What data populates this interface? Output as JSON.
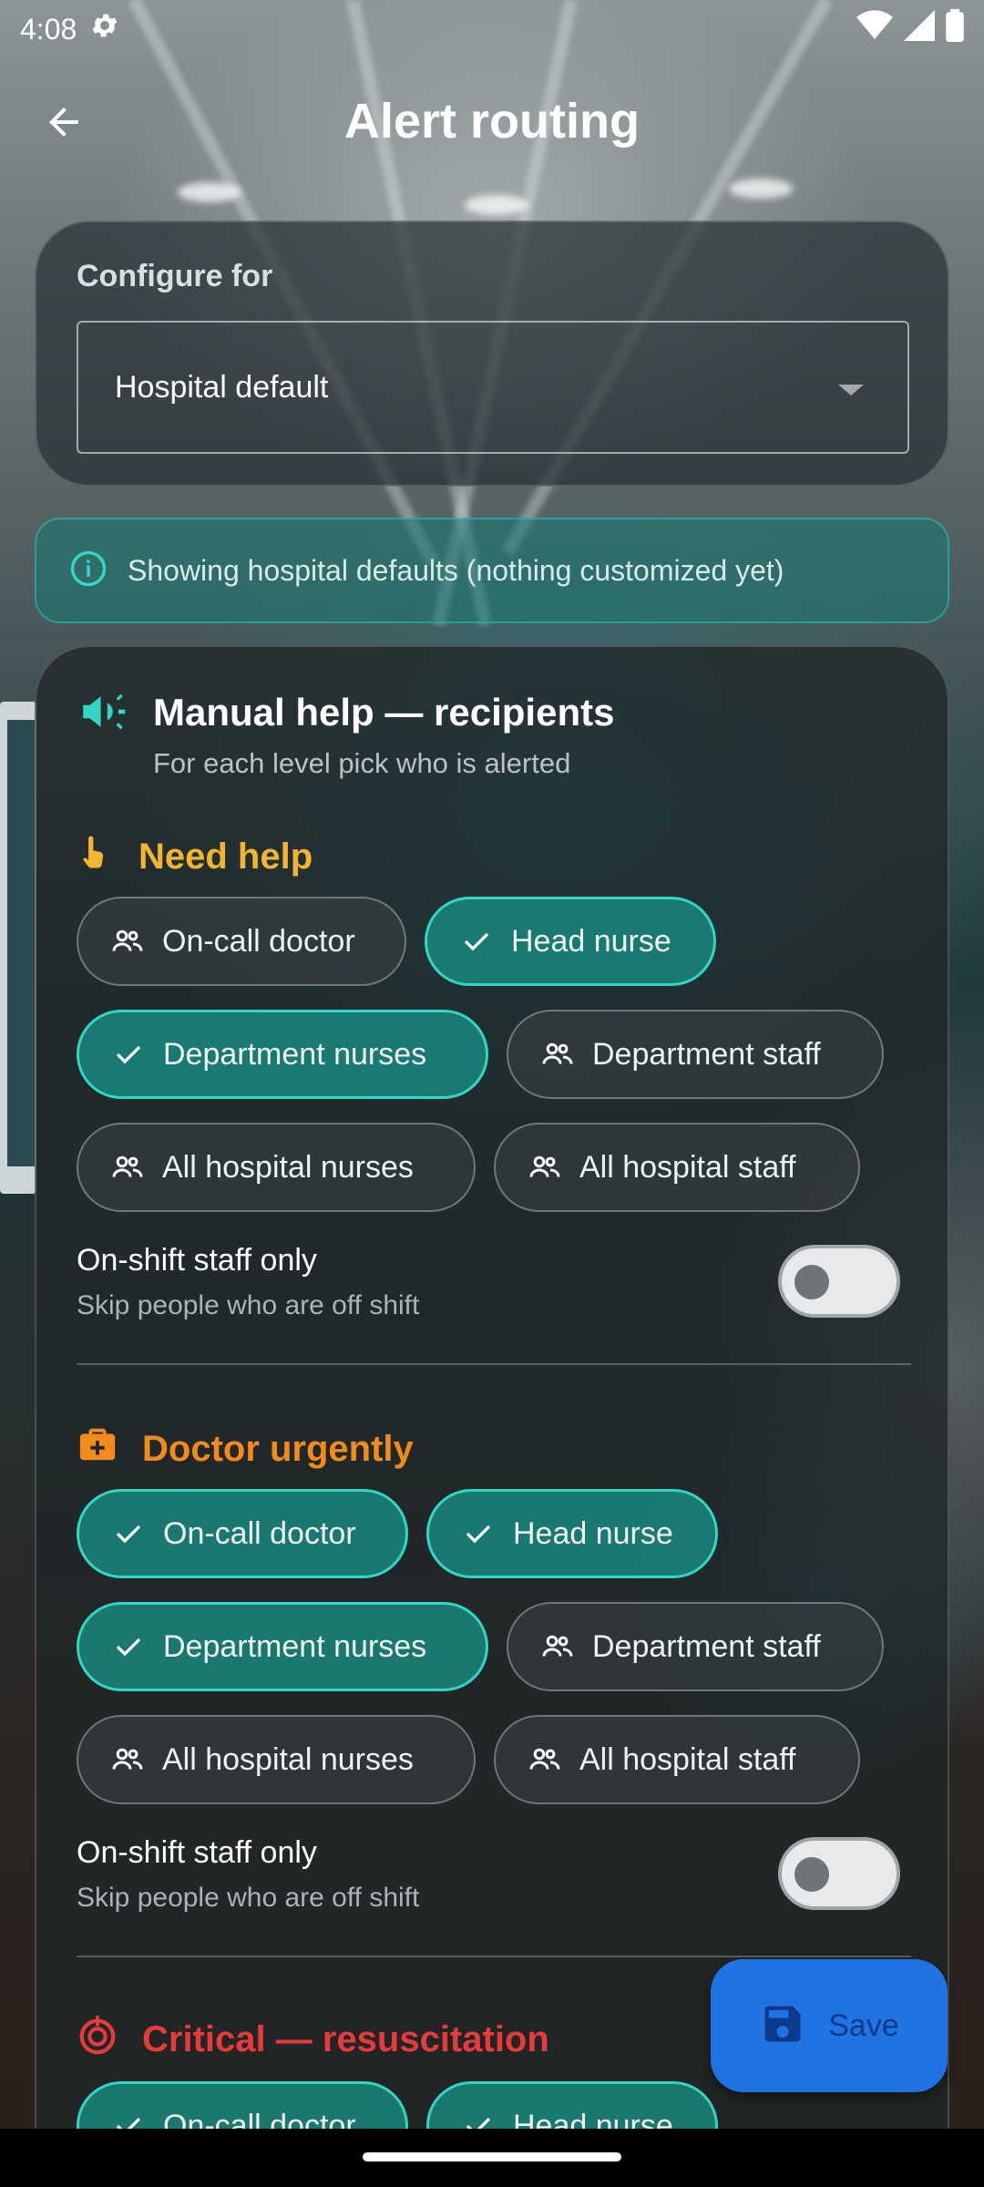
{
  "status_bar": {
    "time": "4:08"
  },
  "app_bar": {
    "title": "Alert routing"
  },
  "config": {
    "label": "Configure for",
    "selected": "Hospital default"
  },
  "info_banner": {
    "text": "Showing hospital defaults (nothing customized yet)"
  },
  "manual_help": {
    "title": "Manual help — recipients",
    "subtitle": "For each level pick who is alerted"
  },
  "sections": [
    {
      "title": "Need help",
      "color": "#f2b531",
      "chips": [
        {
          "label": "On-call doctor",
          "selected": false
        },
        {
          "label": "Head nurse",
          "selected": true
        },
        {
          "label": "Department nurses",
          "selected": true
        },
        {
          "label": "Department staff",
          "selected": false
        },
        {
          "label": "All hospital nurses",
          "selected": false
        },
        {
          "label": "All hospital staff",
          "selected": false
        }
      ],
      "toggle_label": "On-shift staff only",
      "toggle_sub": "Skip people who are off shift",
      "toggle_on": false
    },
    {
      "title": "Doctor urgently",
      "color": "#f28a1e",
      "chips": [
        {
          "label": "On-call doctor",
          "selected": true
        },
        {
          "label": "Head nurse",
          "selected": true
        },
        {
          "label": "Department nurses",
          "selected": true
        },
        {
          "label": "Department staff",
          "selected": false
        },
        {
          "label": "All hospital nurses",
          "selected": false
        },
        {
          "label": "All hospital staff",
          "selected": false
        }
      ],
      "toggle_label": "On-shift staff only",
      "toggle_sub": "Skip people who are off shift",
      "toggle_on": false
    },
    {
      "title": "Critical — resuscitation",
      "color": "#e83a3a",
      "chips": [
        {
          "label": "On-call doctor",
          "selected": true
        },
        {
          "label": "Head nurse",
          "selected": true
        }
      ]
    }
  ],
  "fab": {
    "label": "Save"
  },
  "colors": {
    "accent": "#33d6c2",
    "fab": "#2173e3"
  }
}
